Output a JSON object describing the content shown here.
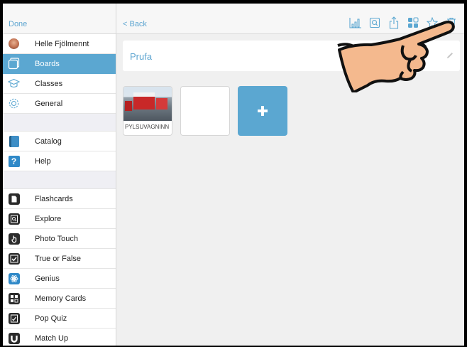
{
  "sidebar": {
    "done_label": "Done",
    "profile": {
      "name": "Helle Fjölmennt"
    },
    "group1": [
      {
        "label": "Boards",
        "icon": "boards-icon",
        "selected": true
      },
      {
        "label": "Classes",
        "icon": "graduation-cap-icon"
      },
      {
        "label": "General",
        "icon": "gear-icon"
      }
    ],
    "group2": [
      {
        "label": "Catalog",
        "icon": "book-icon"
      },
      {
        "label": "Help",
        "icon": "help-icon"
      }
    ],
    "activities": [
      {
        "label": "Flashcards",
        "icon": "flashcards-icon"
      },
      {
        "label": "Explore",
        "icon": "explore-icon"
      },
      {
        "label": "Photo Touch",
        "icon": "photo-touch-icon"
      },
      {
        "label": "True or False",
        "icon": "true-false-icon"
      },
      {
        "label": "Genius",
        "icon": "genius-icon"
      },
      {
        "label": "Memory Cards",
        "icon": "memory-cards-icon"
      },
      {
        "label": "Pop Quiz",
        "icon": "pop-quiz-icon"
      },
      {
        "label": "Match Up",
        "icon": "match-up-icon"
      }
    ]
  },
  "topbar": {
    "back_label": "< Back",
    "icons": [
      "chart-icon",
      "search-icon",
      "share-icon",
      "apps-icon",
      "star-icon",
      "trash-icon"
    ]
  },
  "board": {
    "title": "Prufa",
    "tiles": [
      {
        "caption": "PYLSUVAGNINN"
      }
    ]
  },
  "colors": {
    "accent": "#5ba7d1",
    "link": "#5fa6d1",
    "background": "#f0f0f0"
  }
}
